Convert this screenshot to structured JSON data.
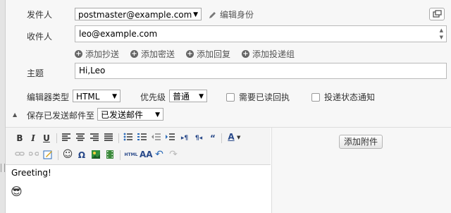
{
  "compose": {
    "from_label": "发件人",
    "from_value": "postmaster@example.com",
    "edit_identity": "编辑身份",
    "to_label": "收件人",
    "to_value": "leo@example.com",
    "add_cc": "添加抄送",
    "add_bcc": "添加密送",
    "add_reply": "添加回复",
    "add_delivery_group": "添加投递组",
    "subject_label": "主题",
    "subject_value": "Hi,Leo"
  },
  "options": {
    "editor_type_label": "编辑器类型",
    "editor_type_value": "HTML",
    "priority_label": "优先级",
    "priority_value": "普通",
    "read_receipt_label": "需要已读回执",
    "delivery_status_label": "投递状态通知",
    "save_sent_label": "保存已发送邮件至",
    "save_sent_value": "已发送邮件"
  },
  "toolbar": {
    "bold": "B",
    "italic": "I",
    "underline": "U",
    "font_color": "A"
  },
  "editor": {
    "body_text": "Greeting!",
    "emoji": "😎"
  },
  "attachments": {
    "add_attachment": "添加附件"
  },
  "colors": {
    "header_bg": "#f7f7f7",
    "toolbar_bg": "#f4f4f4"
  }
}
